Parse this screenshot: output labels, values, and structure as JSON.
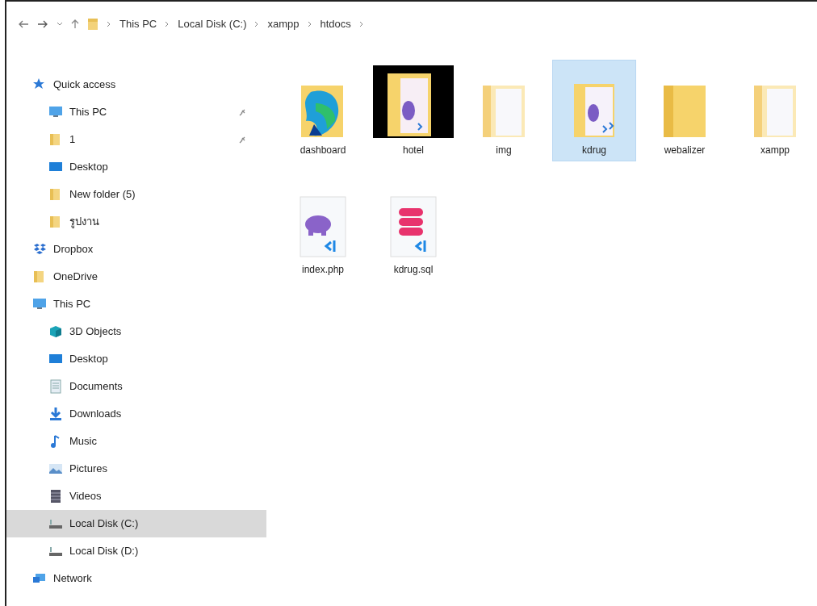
{
  "breadcrumb": {
    "segments": [
      "This PC",
      "Local Disk (C:)",
      "xampp",
      "htdocs"
    ]
  },
  "sidebar": {
    "items": [
      {
        "label": "Quick access",
        "kind": "star",
        "selected": false,
        "children": [
          {
            "label": "This PC",
            "kind": "monitor",
            "pinned": true,
            "selected": false
          },
          {
            "label": "1",
            "kind": "folder",
            "pinned": true,
            "selected": false
          },
          {
            "label": "Desktop",
            "kind": "desktop",
            "pinned": false,
            "selected": false
          },
          {
            "label": "New folder (5)",
            "kind": "folder",
            "pinned": false,
            "selected": false
          },
          {
            "label": "รูปงาน",
            "kind": "folder",
            "pinned": false,
            "selected": false
          }
        ]
      },
      {
        "label": "Dropbox",
        "kind": "dropbox",
        "selected": false
      },
      {
        "label": "OneDrive",
        "kind": "folder",
        "selected": false
      },
      {
        "label": "This PC",
        "kind": "monitor",
        "selected": false,
        "children": [
          {
            "label": "3D Objects",
            "kind": "cube",
            "selected": false
          },
          {
            "label": "Desktop",
            "kind": "desktop",
            "selected": false
          },
          {
            "label": "Documents",
            "kind": "documents",
            "selected": false
          },
          {
            "label": "Downloads",
            "kind": "downloads",
            "selected": false
          },
          {
            "label": "Music",
            "kind": "music",
            "selected": false
          },
          {
            "label": "Pictures",
            "kind": "pictures",
            "selected": false
          },
          {
            "label": "Videos",
            "kind": "videos",
            "selected": false
          },
          {
            "label": "Local Disk (C:)",
            "kind": "drive",
            "selected": true
          },
          {
            "label": "Local Disk (D:)",
            "kind": "drive",
            "selected": false
          }
        ]
      },
      {
        "label": "Network",
        "kind": "network",
        "selected": false
      }
    ]
  },
  "files": [
    {
      "name": "dashboard",
      "kind": "folder-app",
      "selected": false
    },
    {
      "name": "hotel",
      "kind": "folder-dark",
      "selected": false
    },
    {
      "name": "img",
      "kind": "folder-pale",
      "selected": false
    },
    {
      "name": "kdrug",
      "kind": "folder-docs",
      "selected": true
    },
    {
      "name": "webalizer",
      "kind": "folder",
      "selected": false
    },
    {
      "name": "xampp",
      "kind": "folder-pale",
      "selected": false
    },
    {
      "name": "index.php",
      "kind": "php",
      "selected": false
    },
    {
      "name": "kdrug.sql",
      "kind": "sql",
      "selected": false
    }
  ]
}
